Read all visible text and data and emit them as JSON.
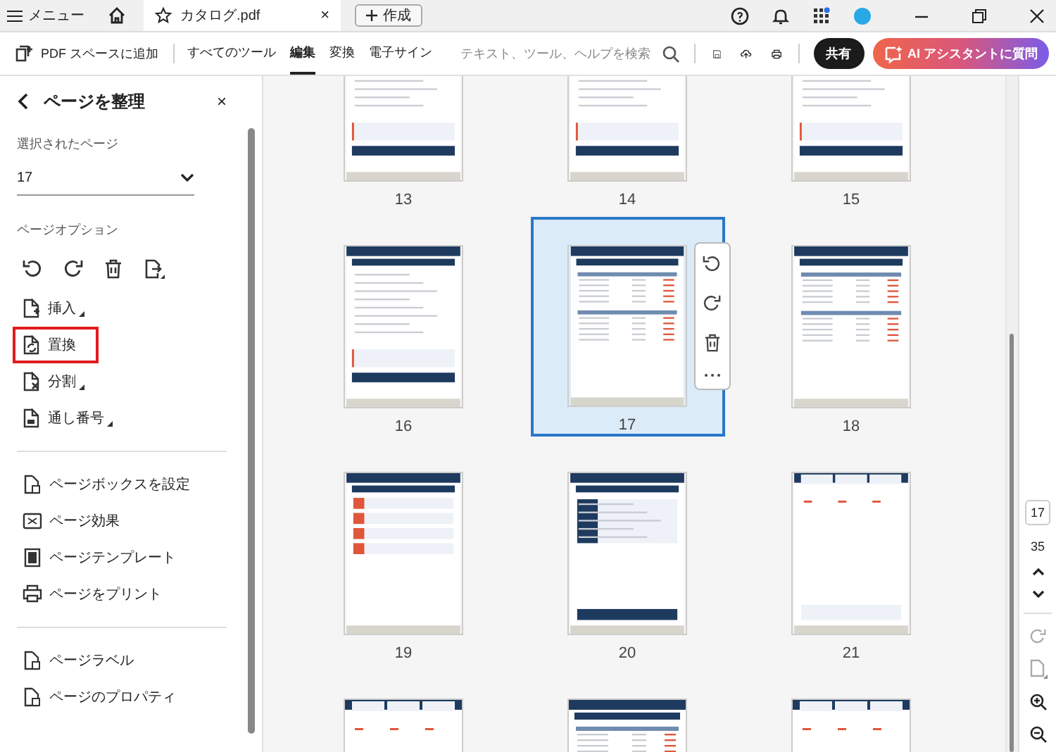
{
  "tab_bar": {
    "menu": "メニュー",
    "tab": {
      "title": "カタログ.pdf",
      "close": "×"
    },
    "create": "作成"
  },
  "toolbar": {
    "add_to_space": "PDF スペースに追加",
    "tabs": [
      {
        "label": "すべてのツール",
        "selected": false
      },
      {
        "label": "編集",
        "selected": true
      },
      {
        "label": "変換",
        "selected": false
      },
      {
        "label": "電子サイン",
        "selected": false
      }
    ],
    "search": {
      "placeholder": "テキスト、ツール、ヘルプを検索"
    },
    "share": "共有",
    "ai": "AI アシスタントに質問"
  },
  "panel": {
    "title": "ページを整理",
    "close": "×",
    "selected_pages_label": "選択されたページ",
    "selected_pages": "17",
    "options_label": "ページオプション",
    "options": [
      {
        "label": "挿入",
        "menu": true,
        "highlighted": false
      },
      {
        "label": "置換",
        "menu": false,
        "highlighted": true
      },
      {
        "label": "分割",
        "menu": true,
        "highlighted": false
      },
      {
        "label": "通し番号",
        "menu": true,
        "highlighted": false
      }
    ],
    "groups": [
      [
        "ページボックスを設定",
        "ページ効果",
        "ページテンプレート",
        "ページをプリント"
      ],
      [
        "ページラベル",
        "ページのプロパティ"
      ]
    ]
  },
  "pages": [
    {
      "number": "13",
      "kind": "text",
      "selected": false
    },
    {
      "number": "14",
      "kind": "text",
      "selected": false
    },
    {
      "number": "15",
      "kind": "text",
      "selected": false
    },
    {
      "number": "16",
      "kind": "text",
      "selected": false
    },
    {
      "number": "17",
      "kind": "table",
      "selected": true
    },
    {
      "number": "18",
      "kind": "table",
      "selected": false
    },
    {
      "number": "19",
      "kind": "list",
      "selected": false
    },
    {
      "number": "20",
      "kind": "form",
      "selected": false
    },
    {
      "number": "21",
      "kind": "cards",
      "selected": false
    },
    {
      "kind": "cards",
      "selected": false
    },
    {
      "kind": "table",
      "selected": false
    },
    {
      "kind": "cards",
      "selected": false
    }
  ],
  "page_nav": {
    "current": "17",
    "total": "35"
  }
}
